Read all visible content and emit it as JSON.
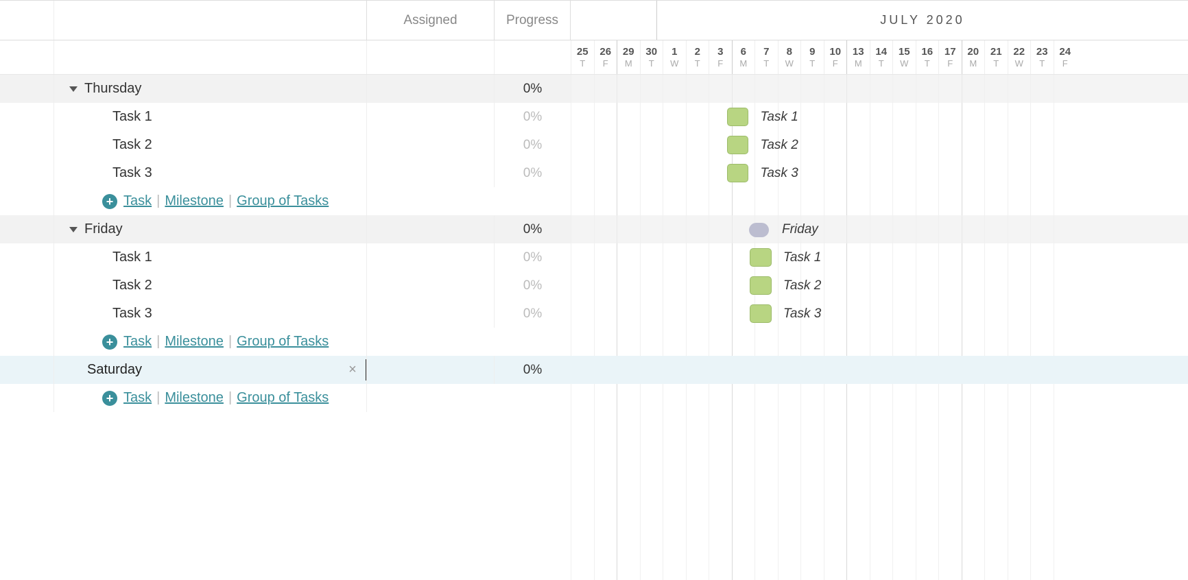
{
  "header": {
    "assigned_label": "Assigned",
    "progress_label": "Progress",
    "month_label": "JULY 2020"
  },
  "dates": [
    {
      "num": "25",
      "dow": "T",
      "wk": false
    },
    {
      "num": "26",
      "dow": "F",
      "wk": false
    },
    {
      "num": "29",
      "dow": "M",
      "wk": true
    },
    {
      "num": "30",
      "dow": "T",
      "wk": false
    },
    {
      "num": "1",
      "dow": "W",
      "wk": false
    },
    {
      "num": "2",
      "dow": "T",
      "wk": false
    },
    {
      "num": "3",
      "dow": "F",
      "wk": false
    },
    {
      "num": "6",
      "dow": "M",
      "wk": true
    },
    {
      "num": "7",
      "dow": "T",
      "wk": false
    },
    {
      "num": "8",
      "dow": "W",
      "wk": false
    },
    {
      "num": "9",
      "dow": "T",
      "wk": false
    },
    {
      "num": "10",
      "dow": "F",
      "wk": false
    },
    {
      "num": "13",
      "dow": "M",
      "wk": true
    },
    {
      "num": "14",
      "dow": "T",
      "wk": false
    },
    {
      "num": "15",
      "dow": "W",
      "wk": false
    },
    {
      "num": "16",
      "dow": "T",
      "wk": false
    },
    {
      "num": "17",
      "dow": "F",
      "wk": false
    },
    {
      "num": "20",
      "dow": "M",
      "wk": true
    },
    {
      "num": "21",
      "dow": "T",
      "wk": false
    },
    {
      "num": "22",
      "dow": "W",
      "wk": false
    },
    {
      "num": "23",
      "dow": "T",
      "wk": false
    },
    {
      "num": "24",
      "dow": "F",
      "wk": false
    }
  ],
  "add_actions": {
    "task": "Task",
    "milestone": "Milestone",
    "group": "Group of Tasks"
  },
  "groups": [
    {
      "name": "Thursday",
      "progress": "0%",
      "tasks": [
        {
          "name": "Task 1",
          "progress": "0%",
          "bar_col": 7,
          "label_col": 9,
          "label": "Task 1"
        },
        {
          "name": "Task 2",
          "progress": "0%",
          "bar_col": 7,
          "label_col": 9,
          "label": "Task 2"
        },
        {
          "name": "Task 3",
          "progress": "0%",
          "bar_col": 7,
          "label_col": 9,
          "label": "Task 3"
        }
      ]
    },
    {
      "name": "Friday",
      "progress": "0%",
      "milestone_col": 8,
      "milestone_label_col": 10,
      "milestone_label": "Friday",
      "tasks": [
        {
          "name": "Task 1",
          "progress": "0%",
          "bar_col": 8,
          "label_col": 10,
          "label": "Task 1"
        },
        {
          "name": "Task 2",
          "progress": "0%",
          "bar_col": 8,
          "label_col": 10,
          "label": "Task 2"
        },
        {
          "name": "Task 3",
          "progress": "0%",
          "bar_col": 8,
          "label_col": 10,
          "label": "Task 3"
        }
      ]
    }
  ],
  "editing_group": {
    "value": "Saturday",
    "progress": "0%"
  }
}
